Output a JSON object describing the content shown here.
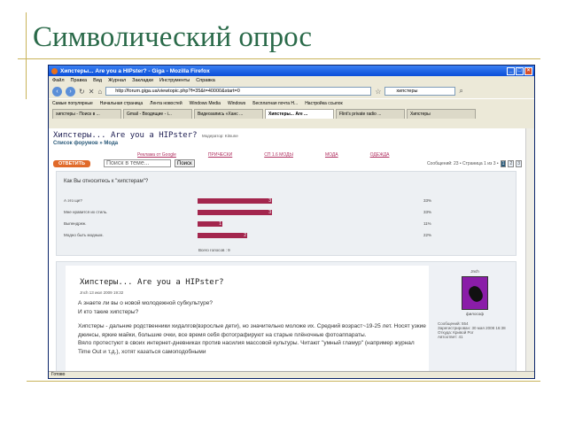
{
  "slide": {
    "title": "Символический опрос"
  },
  "window": {
    "title": "Хипстеры... Are you a HIPster? - Giga - Mozilla Firefox",
    "menu": [
      "Файл",
      "Правка",
      "Вид",
      "Журнал",
      "Закладки",
      "Инструменты",
      "Справка"
    ],
    "address": "http://forum.giga.ua/viewtopic.php?f=35&t=40000&start=0",
    "search": "хипстеры",
    "bookmarks": [
      "Самые популярные",
      "Начальная страница",
      "Лента новостей",
      "Windows Media",
      "Windows",
      "Бесплатная почта H...",
      "Настройка ссылок"
    ],
    "tabs": [
      "хипстеры - Поиск в ...",
      "Gmail - Входящие - i...",
      "Видеозапись «Ханс ...",
      "Хипстеры... Are ...",
      "Flint's private radio ...",
      "Хипстеры"
    ],
    "status": "Готово"
  },
  "forum": {
    "title": "Хипстеры... Are you a HIPster?",
    "moderator": "Модератор: Kitsune",
    "breadcrumb": "Список форумов » Мода",
    "nav_tabs": [
      "Реклама от Google",
      "ПРИЧЕСКИ",
      "СП 1.6 МОДЫ",
      "МОДА",
      "ОДЕЖДА"
    ],
    "reply_label": "ОТВЕТИТЬ",
    "search_placeholder": "Поиск в теме...",
    "search_button": "Поиск",
    "pager_text": "Сообщений: 23 • Страница 1 из 3 •",
    "pages": [
      "1",
      "2",
      "3"
    ]
  },
  "poll": {
    "question": "Как Вы относитесь к \"хипстерам\"?",
    "options": [
      {
        "label": "А это ще?",
        "count": "3",
        "percent": "33%",
        "fraction": 0.33
      },
      {
        "label": "Мне нравится их стиль.",
        "count": "3",
        "percent": "33%",
        "fraction": 0.33
      },
      {
        "label": "Выпендреж.",
        "count": "1",
        "percent": "11%",
        "fraction": 0.11
      },
      {
        "label": "Модно быть модным.",
        "count": "2",
        "percent": "22%",
        "fraction": 0.22
      }
    ],
    "total": "Всего голосов : 9"
  },
  "post": {
    "title": "Хипстеры... Are you a HIPster?",
    "meta": "Jnch 13 июл 2009 19:32",
    "paragraphs": [
      "А знаете ли вы о новой молодежной субкультуре?",
      "И кто такие хипстеры?",
      "Хипстеры - дальние родственники хидалгов(взрослые дети), но значительно моложе их. Средний возраст~19-25 лет. Носят узкие джинсы, яркие майки, большие очки, все время себя фотографируют на старые плёночные фотоаппараты.",
      "Вяло протестуют в своих интернет-дневниках против насилия массовой культуры. Читают \"умный гламур\" (например журнал Time Out и т.д.), хотят казаться самоподобными"
    ]
  },
  "author": {
    "name": "Jnch",
    "role": "философ",
    "stats": [
      "Сообщений: 554",
      "Зарегистрирован: 30 мая 2008 16:38",
      "Откуда: Кривой Рог",
      "Автоответ: 41"
    ]
  },
  "colors": {
    "accent": "#2a6a49",
    "bar": "#a3264d",
    "rule": "#c9b35a"
  }
}
